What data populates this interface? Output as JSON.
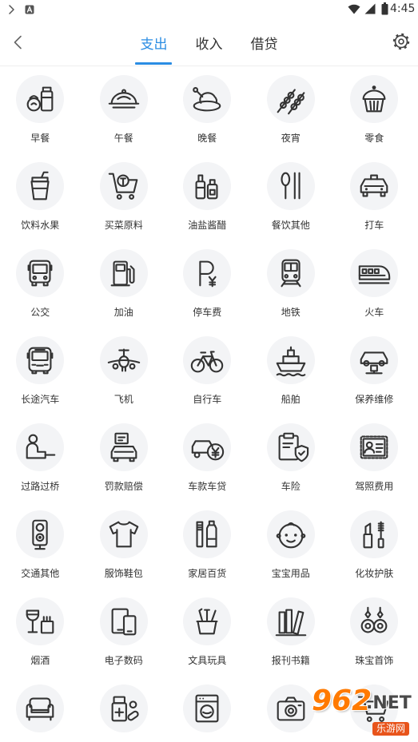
{
  "status_bar": {
    "time": "4:45",
    "left_icons": [
      "chevron-right-icon",
      "notification-a-icon"
    ],
    "right_icons": [
      "wifi-icon",
      "signal-icon",
      "battery-icon"
    ]
  },
  "header": {
    "back_icon": "back-arrow-icon",
    "settings_icon": "gear-icon",
    "tabs": [
      {
        "label": "支出",
        "active": true
      },
      {
        "label": "收入",
        "active": false
      },
      {
        "label": "借贷",
        "active": false
      }
    ]
  },
  "colors": {
    "accent": "#2b8de3",
    "icon_bg": "#f3f4f6",
    "icon_stroke": "#333333",
    "text": "#333333"
  },
  "categories": [
    {
      "label": "早餐",
      "icon": "breakfast-icon"
    },
    {
      "label": "午餐",
      "icon": "lunch-icon"
    },
    {
      "label": "晚餐",
      "icon": "dinner-icon"
    },
    {
      "label": "夜宵",
      "icon": "midnight-snack-icon"
    },
    {
      "label": "零食",
      "icon": "snack-icon"
    },
    {
      "label": "饮料水果",
      "icon": "drink-fruit-icon"
    },
    {
      "label": "买菜原料",
      "icon": "grocery-icon"
    },
    {
      "label": "油盐酱醋",
      "icon": "condiment-icon"
    },
    {
      "label": "餐饮其他",
      "icon": "dining-other-icon"
    },
    {
      "label": "打车",
      "icon": "taxi-icon"
    },
    {
      "label": "公交",
      "icon": "bus-icon"
    },
    {
      "label": "加油",
      "icon": "fuel-icon"
    },
    {
      "label": "停车费",
      "icon": "parking-icon"
    },
    {
      "label": "地铁",
      "icon": "subway-icon"
    },
    {
      "label": "火车",
      "icon": "train-icon"
    },
    {
      "label": "长途汽车",
      "icon": "coach-icon"
    },
    {
      "label": "飞机",
      "icon": "airplane-icon"
    },
    {
      "label": "自行车",
      "icon": "bicycle-icon"
    },
    {
      "label": "船舶",
      "icon": "ship-icon"
    },
    {
      "label": "保养维修",
      "icon": "maintenance-icon"
    },
    {
      "label": "过路过桥",
      "icon": "toll-icon"
    },
    {
      "label": "罚款赔偿",
      "icon": "fine-icon"
    },
    {
      "label": "车款车贷",
      "icon": "car-loan-icon"
    },
    {
      "label": "车险",
      "icon": "car-insurance-icon"
    },
    {
      "label": "驾照费用",
      "icon": "license-icon"
    },
    {
      "label": "交通其他",
      "icon": "traffic-other-icon"
    },
    {
      "label": "服饰鞋包",
      "icon": "clothing-icon"
    },
    {
      "label": "家居百货",
      "icon": "household-icon"
    },
    {
      "label": "宝宝用品",
      "icon": "baby-icon"
    },
    {
      "label": "化妆护肤",
      "icon": "cosmetics-icon"
    },
    {
      "label": "烟酒",
      "icon": "tobacco-alcohol-icon"
    },
    {
      "label": "电子数码",
      "icon": "electronics-icon"
    },
    {
      "label": "文具玩具",
      "icon": "stationery-icon"
    },
    {
      "label": "报刊书籍",
      "icon": "books-icon"
    },
    {
      "label": "珠宝首饰",
      "icon": "jewelry-icon"
    },
    {
      "icon": "furniture-icon"
    },
    {
      "icon": "medicine-icon"
    },
    {
      "icon": "appliance-icon"
    },
    {
      "icon": "camera-icon"
    },
    {
      "icon": "shopping-cart-icon"
    }
  ],
  "watermark": {
    "brand_number": "962",
    "brand_domain": ".NET",
    "name": "乐游网"
  }
}
